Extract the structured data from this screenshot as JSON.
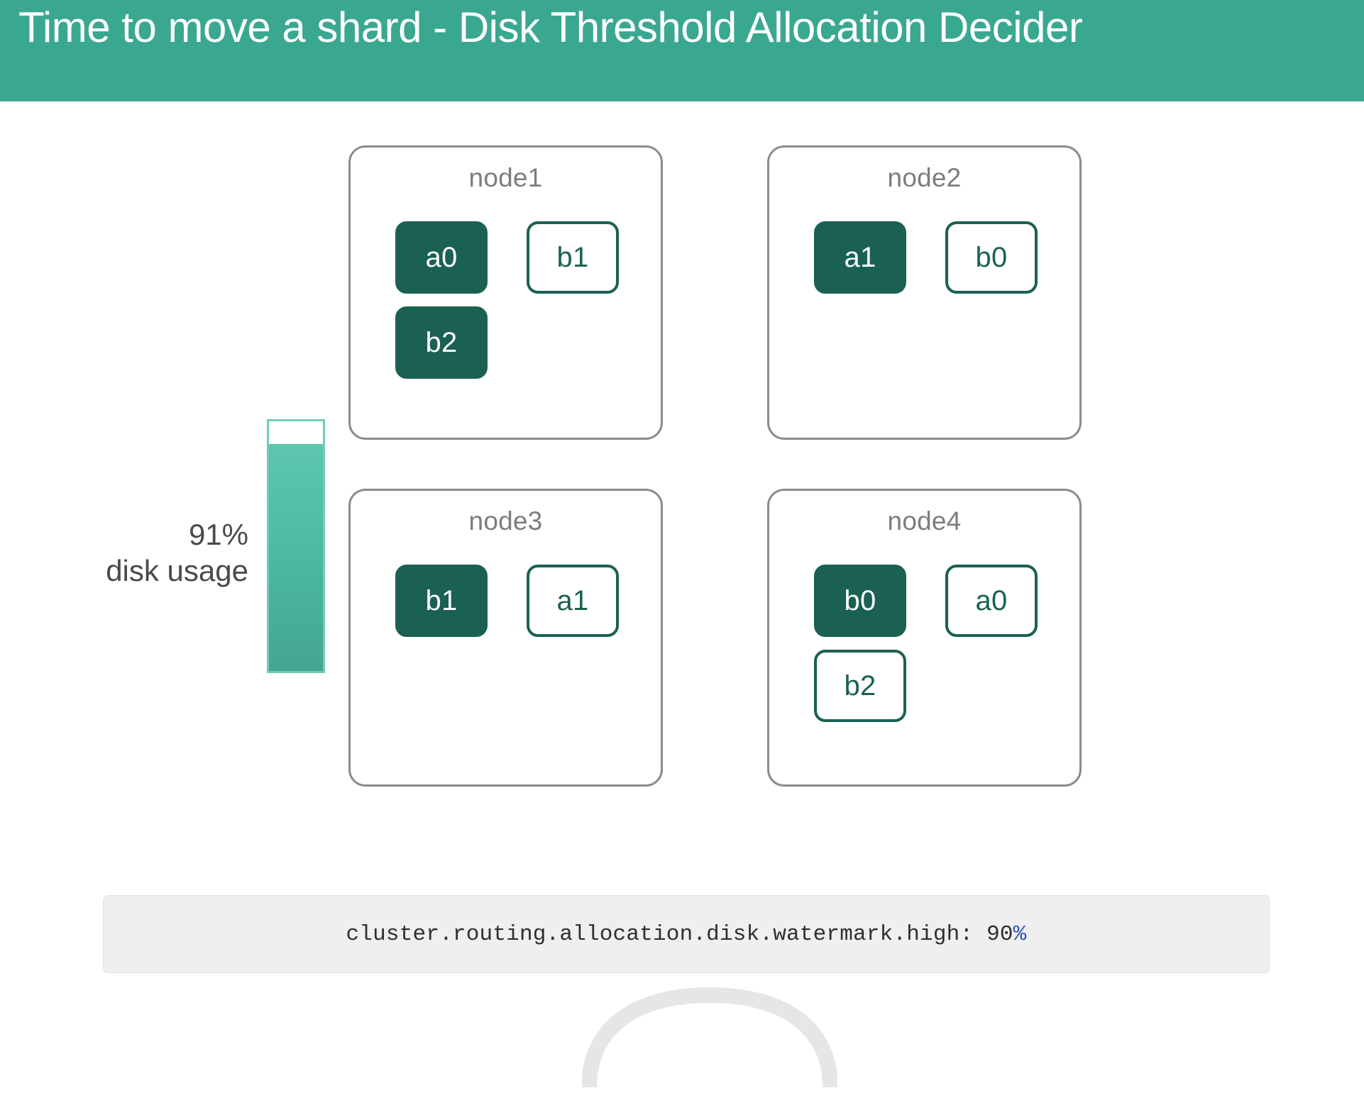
{
  "header": {
    "title": "Time to move a shard - Disk Threshold Allocation Decider",
    "background_color": "#3aa891",
    "text_color": "#ffffff"
  },
  "colors": {
    "teal_header": "#3aa891",
    "shard_filled": "#1a6153",
    "shard_outline": "#1a6153",
    "node_border": "#8c8c8c",
    "node_title": "#7d7d7d",
    "meter_fill_top": "#5ec6ae",
    "meter_fill_bottom": "#44a692",
    "meter_border": "#6fcdb7",
    "code_background": "#efefef",
    "code_text": "#2f2f2f",
    "code_value_accent": "#2b55b5",
    "label_text": "#4a4a4a"
  },
  "disk_meter": {
    "usage_percent": 91,
    "percent_label": "91%",
    "caption": "disk usage"
  },
  "nodes": [
    {
      "id": "node1",
      "title": "node1",
      "shards": [
        {
          "label": "a0",
          "style": "filled",
          "slot": "r0c0"
        },
        {
          "label": "b1",
          "style": "outlined",
          "slot": "r0c1"
        },
        {
          "label": "b2",
          "style": "filled",
          "slot": "r1c0"
        }
      ]
    },
    {
      "id": "node2",
      "title": "node2",
      "shards": [
        {
          "label": "a1",
          "style": "filled",
          "slot": "r0c0"
        },
        {
          "label": "b0",
          "style": "outlined",
          "slot": "r0c1"
        }
      ]
    },
    {
      "id": "node3",
      "title": "node3",
      "shards": [
        {
          "label": "b1",
          "style": "filled",
          "slot": "r0c0"
        },
        {
          "label": "a1",
          "style": "outlined",
          "slot": "r0c1"
        }
      ]
    },
    {
      "id": "node4",
      "title": "node4",
      "shards": [
        {
          "label": "b0",
          "style": "filled",
          "slot": "r0c0"
        },
        {
          "label": "a0",
          "style": "outlined",
          "slot": "r0c1"
        },
        {
          "label": "b2",
          "style": "outlined",
          "slot": "r1c0"
        }
      ]
    }
  ],
  "setting": {
    "key": "cluster.routing.allocation.disk.watermark.high:",
    "value_number": "90",
    "value_unit": "%",
    "full_text": "cluster.routing.allocation.disk.watermark.high: 90%"
  }
}
